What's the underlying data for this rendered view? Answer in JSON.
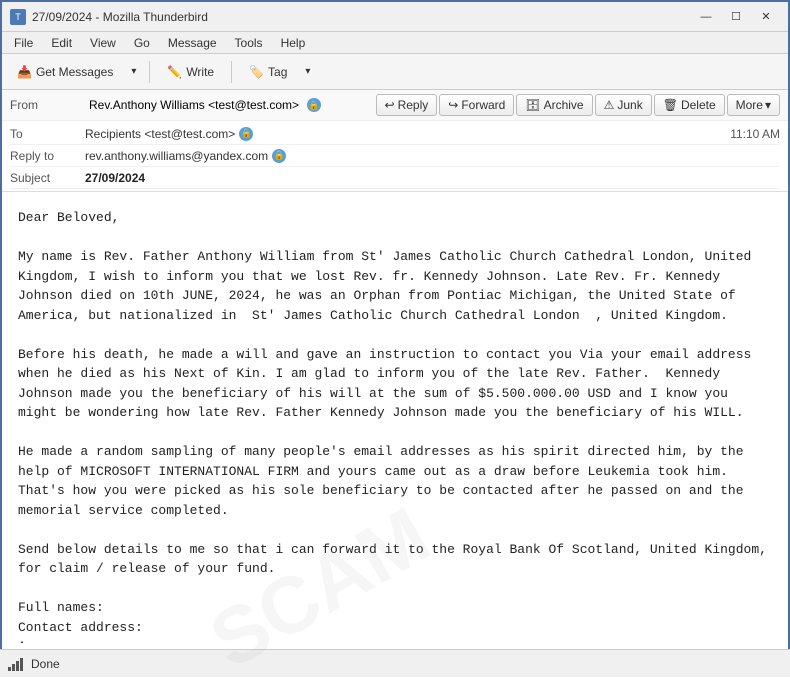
{
  "titlebar": {
    "title": "27/09/2024 - Mozilla Thunderbird",
    "icon_label": "T",
    "minimize": "—",
    "maximize": "☐",
    "close": "✕"
  },
  "menubar": {
    "items": [
      "File",
      "Edit",
      "View",
      "Go",
      "Message",
      "Tools",
      "Help"
    ]
  },
  "toolbar": {
    "get_messages_label": "Get Messages",
    "write_label": "Write",
    "tag_label": "Tag"
  },
  "email_header": {
    "from_label": "From",
    "from_value": "Rev.Anthony Williams <test@test.com>",
    "to_label": "To",
    "to_value": "Recipients <test@test.com>",
    "reply_to_label": "Reply to",
    "reply_to_value": "rev.anthony.williams@yandex.com",
    "subject_label": "Subject",
    "subject_value": "27/09/2024",
    "time": "11:10 AM",
    "reply_btn": "Reply",
    "forward_btn": "Forward",
    "archive_btn": "Archive",
    "junk_btn": "Junk",
    "delete_btn": "Delete",
    "more_btn": "More"
  },
  "email_body": "Dear Beloved,\n\nMy name is Rev. Father Anthony William from St' James Catholic Church Cathedral London, United Kingdom, I wish to inform you that we lost Rev. fr. Kennedy Johnson. Late Rev. Fr. Kennedy Johnson died on 10th JUNE, 2024, he was an Orphan from Pontiac Michigan, the United State of America, but nationalized in  St' James Catholic Church Cathedral London  , United Kingdom.\n\nBefore his death, he made a will and gave an instruction to contact you Via your email address when he died as his Next of Kin. I am glad to inform you of the late Rev. Father.  Kennedy Johnson made you the beneficiary of his will at the sum of $5.500.000.00 USD and I know you might be wondering how late Rev. Father Kennedy Johnson made you the beneficiary of his WILL.\n\nHe made a random sampling of many people's email addresses as his spirit directed him, by the help of MICROSOFT INTERNATIONAL FIRM and yours came out as a draw before Leukemia took him. That's how you were picked as his sole beneficiary to be contacted after he passed on and the memorial service completed.\n\nSend below details to me so that i can forward it to the Royal Bank Of Scotland, United Kingdom, for claim / release of your fund.\n\nFull names:\nContact address:\nAge:\nOccupation:\nNext of kin:\nValid ID:\nprivate phone number:\n\nThank you & remain blessed,\nRev. Father. Anthony Williams",
  "statusbar": {
    "done_label": "Done"
  }
}
